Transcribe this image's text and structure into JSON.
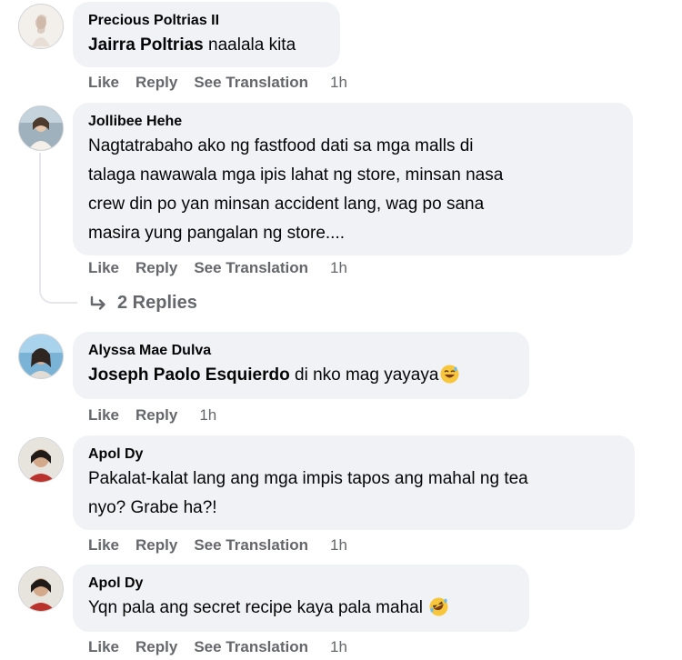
{
  "actions": {
    "like": "Like",
    "reply": "Reply",
    "translate": "See Translation"
  },
  "comments": [
    {
      "author": "Precious Poltrias II",
      "mention": "Jairra Poltrias",
      "text": " naalala kita",
      "time": "1h"
    },
    {
      "author": "Jollibee Hehe",
      "lines": [
        "Nagtatrabaho ako ng fastfood dati sa mga malls di",
        "talaga nawawala mga ipis lahat ng store, minsan nasa",
        "crew din po yan minsan accident lang, wag po sana",
        "masira yung pangalan ng store...."
      ],
      "time": "1h",
      "replies_label": "2 Replies"
    },
    {
      "author": "Alyssa Mae Dulva",
      "mention": "Joseph Paolo Esquierdo",
      "text": " di nko mag yayaya",
      "emoji": "grinning-sweat-emoji",
      "time": "1h"
    },
    {
      "author": "Apol Dy",
      "lines": [
        "Pakalat-kalat lang ang mga impis tapos ang mahal ng tea",
        "nyo? Grabe ha?!"
      ],
      "time": "1h"
    },
    {
      "author": "Apol Dy",
      "text": "Yqn pala ang secret recipe kaya pala mahal ",
      "emoji": "rofl-emoji",
      "time": "1h"
    }
  ]
}
